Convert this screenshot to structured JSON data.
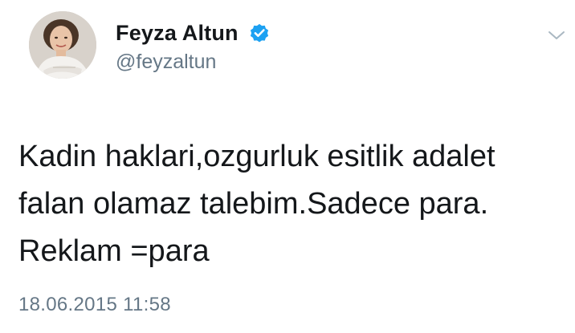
{
  "tweet": {
    "author": {
      "display_name": "Feyza Altun",
      "handle": "@feyzaltun",
      "verified": true,
      "avatar_icon": "profile-photo"
    },
    "text": "Kadin haklari,ozgurluk esitlik adalet\nfalan olamaz talebim.Sadece para.\nReklam =para",
    "timestamp": "18.06.2015 11:58",
    "icons": {
      "verified": "verified-badge-icon",
      "menu": "chevron-down-icon"
    }
  },
  "colors": {
    "text_primary": "#14171a",
    "text_secondary": "#657786",
    "verified_blue": "#1da1f2",
    "chevron": "#aab8c2",
    "background": "#ffffff"
  }
}
